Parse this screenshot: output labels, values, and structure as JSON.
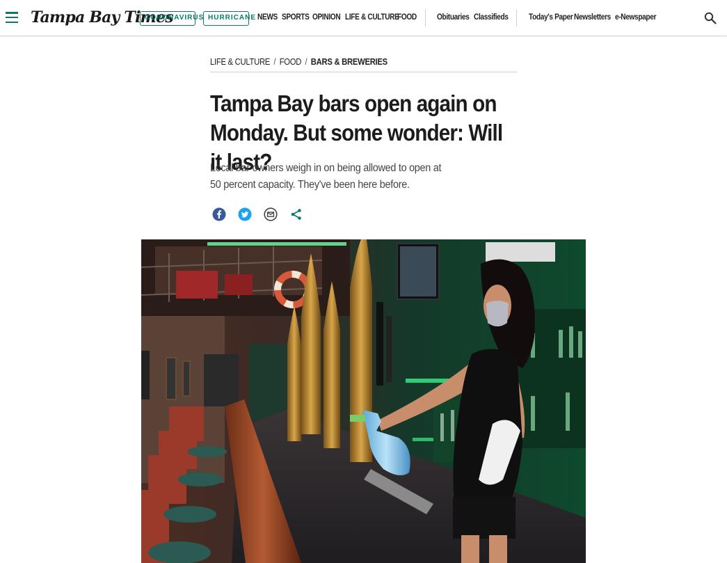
{
  "header": {
    "logo": "Tampa Bay Times",
    "pills": [
      "CORONAVIRUS",
      "HURRICANE"
    ],
    "nav_primary": [
      "NEWS",
      "SPORTS",
      "OPINION",
      "LIFE & CULTURE",
      "FOOD"
    ],
    "nav_secondary": [
      "Obituaries",
      "Classifieds"
    ],
    "nav_tertiary": [
      "Today's Paper",
      "Newsletters",
      "e-Newspaper"
    ],
    "icons": {
      "menu": "hamburger-menu-icon",
      "search": "search-icon"
    },
    "accent_color": "#0c7a6a"
  },
  "article": {
    "breadcrumb": [
      "LIFE & CULTURE",
      "FOOD",
      "BARS & BREWERIES"
    ],
    "headline": "Tampa Bay bars open again on Monday. But some wonder: Will it last?",
    "dek": "Local bar owners weigh in on being allowed to open at 50 percent capacity. They've been here before.",
    "share_icons": [
      "facebook-icon",
      "twitter-icon",
      "email-icon",
      "share-icon"
    ],
    "share_colors": {
      "facebook": "#3b5998",
      "twitter": "#1da1f2",
      "email": "#444444",
      "share": "#0c7a6a"
    }
  }
}
